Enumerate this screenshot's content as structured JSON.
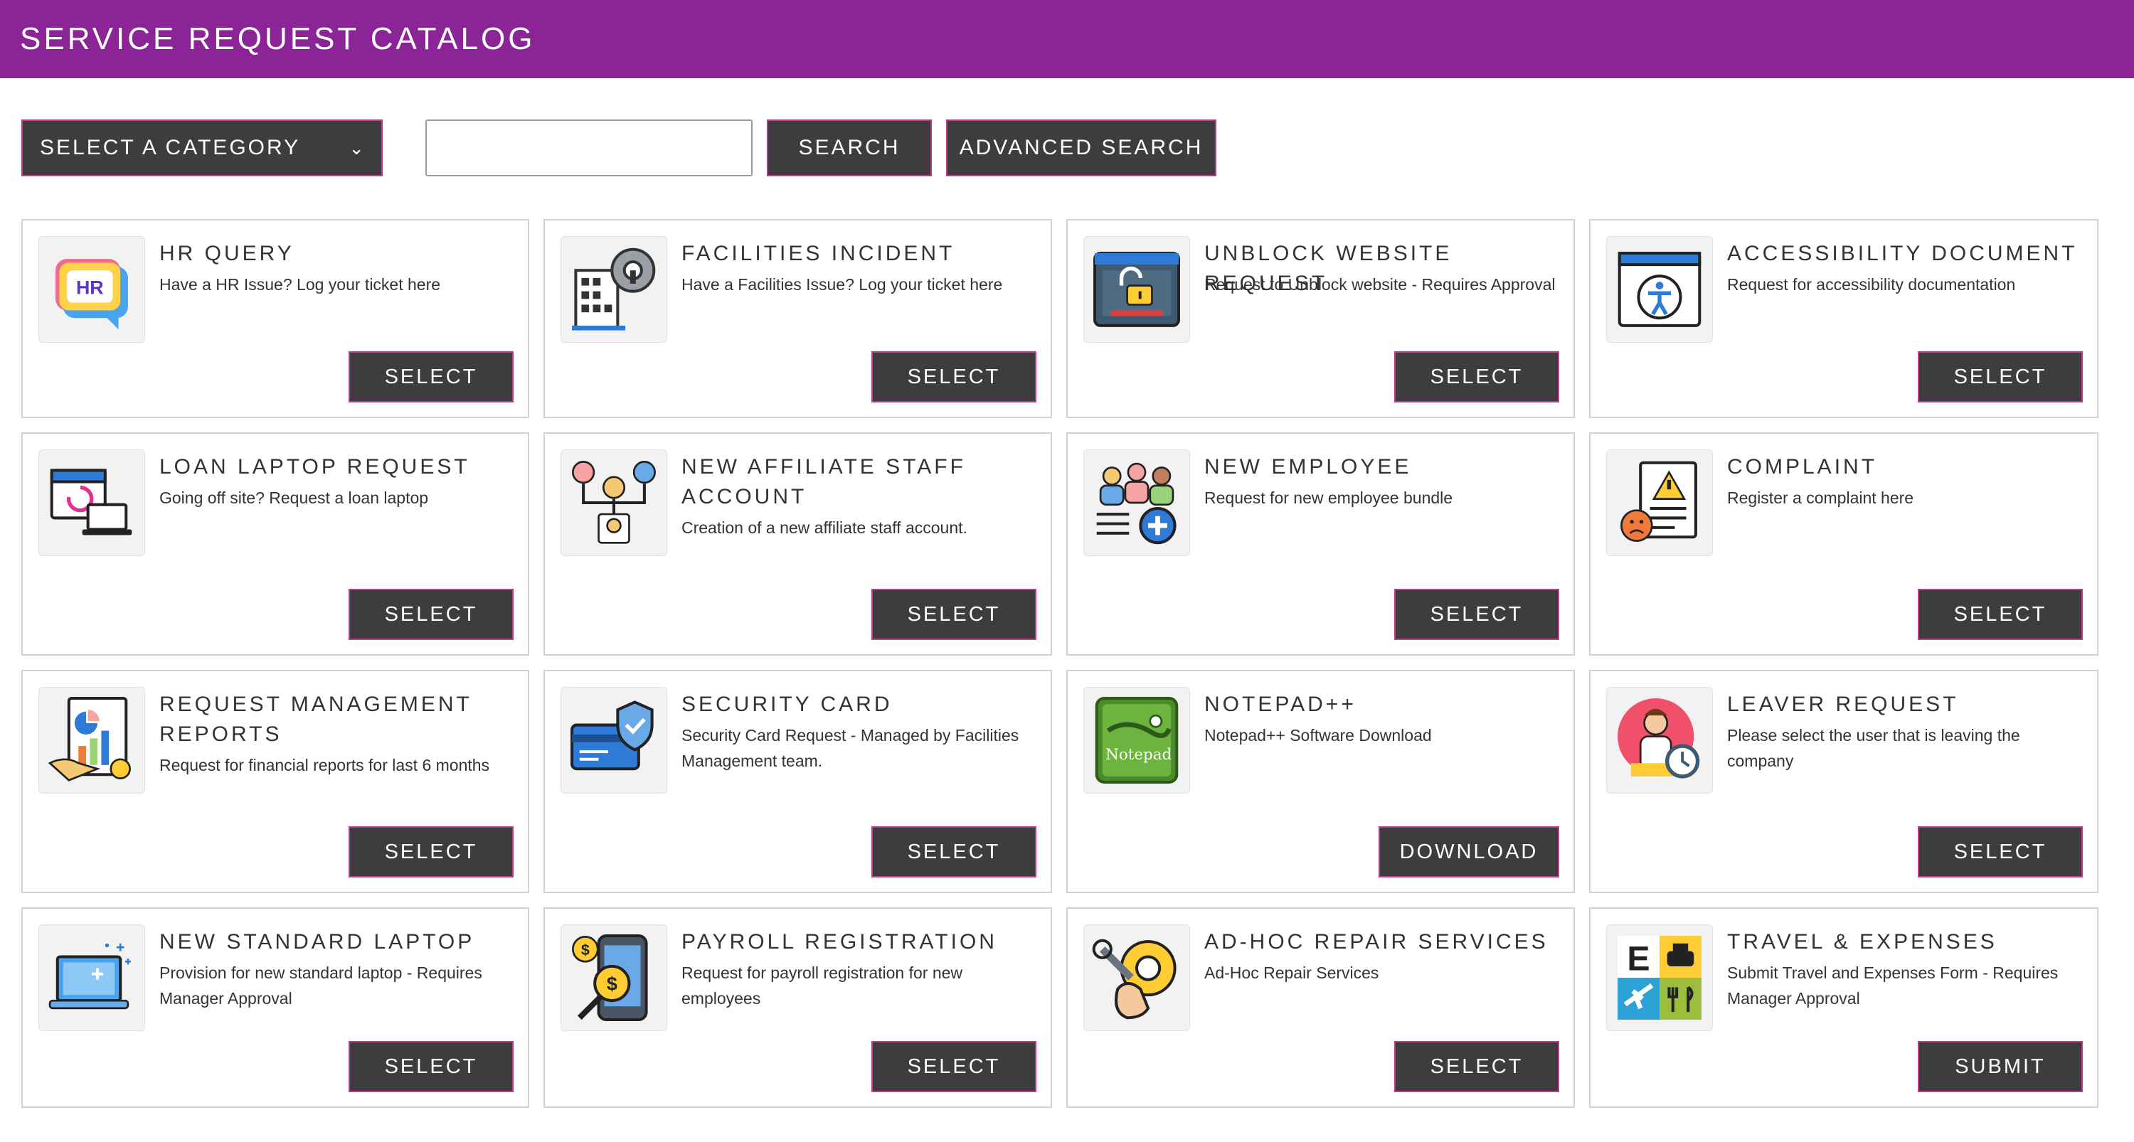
{
  "header": {
    "title": "SERVICE REQUEST CATALOG"
  },
  "toolbar": {
    "category_label": "SELECT A CATEGORY",
    "search_value": "",
    "search_label": "SEARCH",
    "advanced_search_label": "ADVANCED SEARCH"
  },
  "colors": {
    "header_bg": "#8b2597",
    "button_bg": "#3d3d3d",
    "button_border": "#c0398f"
  },
  "cards": [
    {
      "title": "HR QUERY",
      "description": "Have a HR Issue? Log your ticket here",
      "action": "SELECT",
      "icon": "hr-chat-icon"
    },
    {
      "title": "FACILITIES INCIDENT",
      "description": "Have a Facilities Issue? Log your ticket here",
      "action": "SELECT",
      "icon": "building-gear-icon"
    },
    {
      "title": "UNBLOCK WEBSITE REQUEST",
      "description": "Request to Unblock website - Requires Approval",
      "action": "SELECT",
      "icon": "browser-lock-icon"
    },
    {
      "title": "ACCESSIBILITY DOCUMENT",
      "description": "Request for accessibility documentation",
      "action": "SELECT",
      "icon": "accessibility-window-icon"
    },
    {
      "title": "LOAN LAPTOP REQUEST",
      "description": "Going off site? Request a loan laptop",
      "action": "SELECT",
      "icon": "calendar-laptop-icon"
    },
    {
      "title": "NEW AFFILIATE STAFF ACCOUNT",
      "description": "Creation of a new affiliate staff account.",
      "action": "SELECT",
      "icon": "org-chart-icon"
    },
    {
      "title": "NEW EMPLOYEE",
      "description": "Request for new employee bundle",
      "action": "SELECT",
      "icon": "people-add-icon"
    },
    {
      "title": "COMPLAINT",
      "description": "Register a complaint here",
      "action": "SELECT",
      "icon": "complaint-document-icon"
    },
    {
      "title": "REQUEST MANAGEMENT REPORTS",
      "description": "Request for financial reports for last 6 months",
      "action": "SELECT",
      "icon": "report-chart-icon"
    },
    {
      "title": "SECURITY CARD",
      "description": "Security Card Request - Managed by Facilities Management team.",
      "action": "SELECT",
      "icon": "security-card-icon"
    },
    {
      "title": "NOTEPAD++",
      "description": "Notepad++ Software Download",
      "action": "DOWNLOAD",
      "icon": "notepad-plus-plus-icon"
    },
    {
      "title": "LEAVER REQUEST",
      "description": "Please select the user that is leaving the company",
      "action": "SELECT",
      "icon": "leaver-timer-icon"
    },
    {
      "title": "NEW STANDARD LAPTOP",
      "description": "Provision for new standard laptop - Requires Manager Approval",
      "action": "SELECT",
      "icon": "laptop-sparkle-icon"
    },
    {
      "title": "PAYROLL REGISTRATION",
      "description": "Request for payroll registration for new employees",
      "action": "SELECT",
      "icon": "payroll-phone-icon"
    },
    {
      "title": "AD-HOC REPAIR SERVICES",
      "description": "Ad-Hoc Repair Services",
      "action": "SELECT",
      "icon": "repair-tools-icon"
    },
    {
      "title": "TRAVEL & EXPENSES",
      "description": "Submit Travel and Expenses Form - Requires Manager Approval",
      "action": "SUBMIT",
      "icon": "travel-expenses-icon"
    }
  ]
}
